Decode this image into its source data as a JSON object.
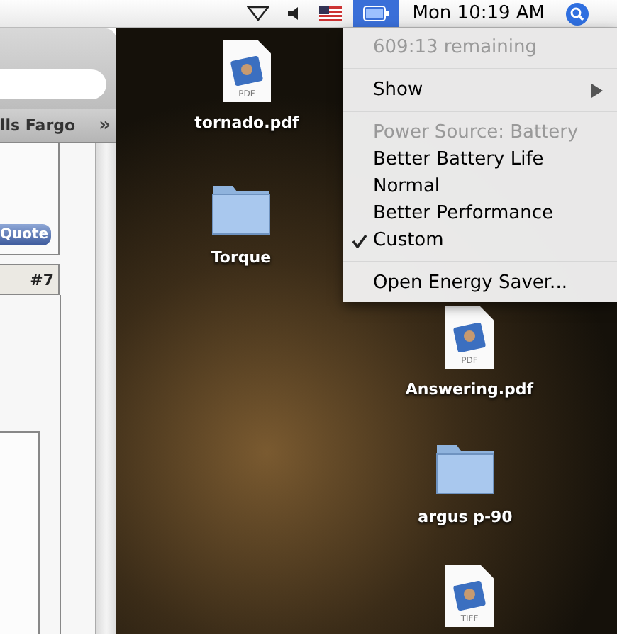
{
  "menubar": {
    "clock": "Mon 10:19 AM",
    "battery_menu_open": true
  },
  "browser": {
    "bookmark": "lls Fargo",
    "bookmark_overflow": "»",
    "quote_button": "Quote",
    "post_number": "#7"
  },
  "battery_menu": [
    {
      "kind": "info",
      "label": "609:13 remaining"
    },
    {
      "kind": "separator"
    },
    {
      "kind": "submenu",
      "label": "Show"
    },
    {
      "kind": "separator"
    },
    {
      "kind": "header",
      "label": "Power Source: Battery"
    },
    {
      "kind": "option",
      "label": "Better Battery Life",
      "selected": false
    },
    {
      "kind": "option",
      "label": "Normal",
      "selected": false
    },
    {
      "kind": "option",
      "label": "Better Performance",
      "selected": false
    },
    {
      "kind": "option",
      "label": "Custom",
      "selected": true
    },
    {
      "kind": "separator"
    },
    {
      "kind": "action",
      "label": "Open Energy Saver..."
    }
  ],
  "desktop_icons": [
    {
      "kind": "file",
      "badge": "PDF",
      "label": "tornado.pdf"
    },
    {
      "kind": "folder",
      "label": "Torque"
    },
    {
      "kind": "file",
      "badge": "PDF",
      "label": "Answering.pdf"
    },
    {
      "kind": "folder",
      "label": "argus p-90"
    },
    {
      "kind": "file",
      "badge": "TIFF"
    }
  ]
}
